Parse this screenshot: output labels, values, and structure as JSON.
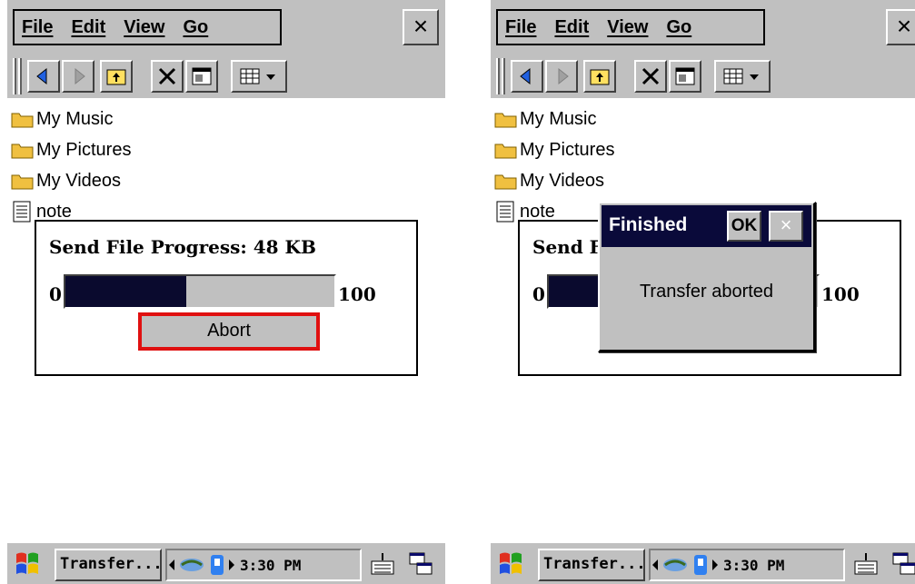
{
  "menu": {
    "file": "File",
    "edit": "Edit",
    "view": "View",
    "go": "Go",
    "close_glyph": "×"
  },
  "toolbar_icons": [
    "back-icon",
    "forward-icon",
    "up-folder-icon",
    "delete-icon",
    "properties-icon",
    "view-menu-icon"
  ],
  "files": [
    {
      "name": "My Music",
      "icon": "folder-icon"
    },
    {
      "name": "My Pictures",
      "icon": "folder-icon"
    },
    {
      "name": "My Videos",
      "icon": "folder-icon"
    },
    {
      "name": "note",
      "icon": "document-icon"
    }
  ],
  "progress": {
    "title": "Send File Progress: 48 KB",
    "title_truncated": "Send F",
    "min_label": "0",
    "max_label": "100",
    "value_percent": 45,
    "abort_label": "Abort"
  },
  "finished_dialog": {
    "title": "Finished",
    "ok_label": "OK",
    "close_glyph": "×",
    "message": "Transfer aborted"
  },
  "taskbar": {
    "task_label": "Transfer...",
    "clock": "3:30 PM"
  },
  "colors": {
    "highlight": "#e01010",
    "titlebar": "#0a0a3a",
    "progress_fill": "#0a0a2e",
    "chrome": "#c0c0c0"
  }
}
